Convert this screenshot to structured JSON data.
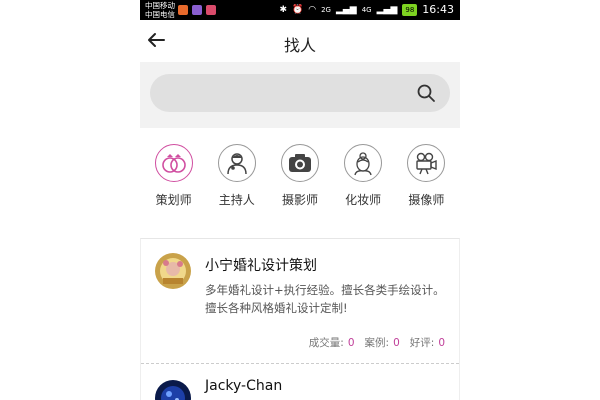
{
  "status_bar": {
    "carrier_1": "中国移动",
    "carrier_2": "中国电信",
    "network": "2G",
    "network_2": "4G",
    "battery": "98",
    "time": "16:43"
  },
  "header": {
    "title": "找人"
  },
  "search": {
    "placeholder": ""
  },
  "categories": [
    {
      "label": "策划师",
      "icon": "rings-icon"
    },
    {
      "label": "主持人",
      "icon": "host-icon"
    },
    {
      "label": "摄影师",
      "icon": "camera-icon"
    },
    {
      "label": "化妆师",
      "icon": "makeup-artist-icon"
    },
    {
      "label": "摄像师",
      "icon": "video-camera-icon"
    }
  ],
  "cards": [
    {
      "name": "小宁婚礼设计策划",
      "description": "多年婚礼设计+执行经验。擅长各类手绘设计。擅长各种风格婚礼设计定制!",
      "stats": {
        "deals_label": "成交量:",
        "deals": "0",
        "cases_label": "案例:",
        "cases": "0",
        "reviews_label": "好评:",
        "reviews": "0"
      }
    },
    {
      "name": "Jacky-Chan"
    }
  ],
  "colors": {
    "accent": "#c0409a",
    "status_bar_bg": "#000000",
    "search_bg": "#f2f2f2",
    "search_box": "#e0e0e0"
  }
}
